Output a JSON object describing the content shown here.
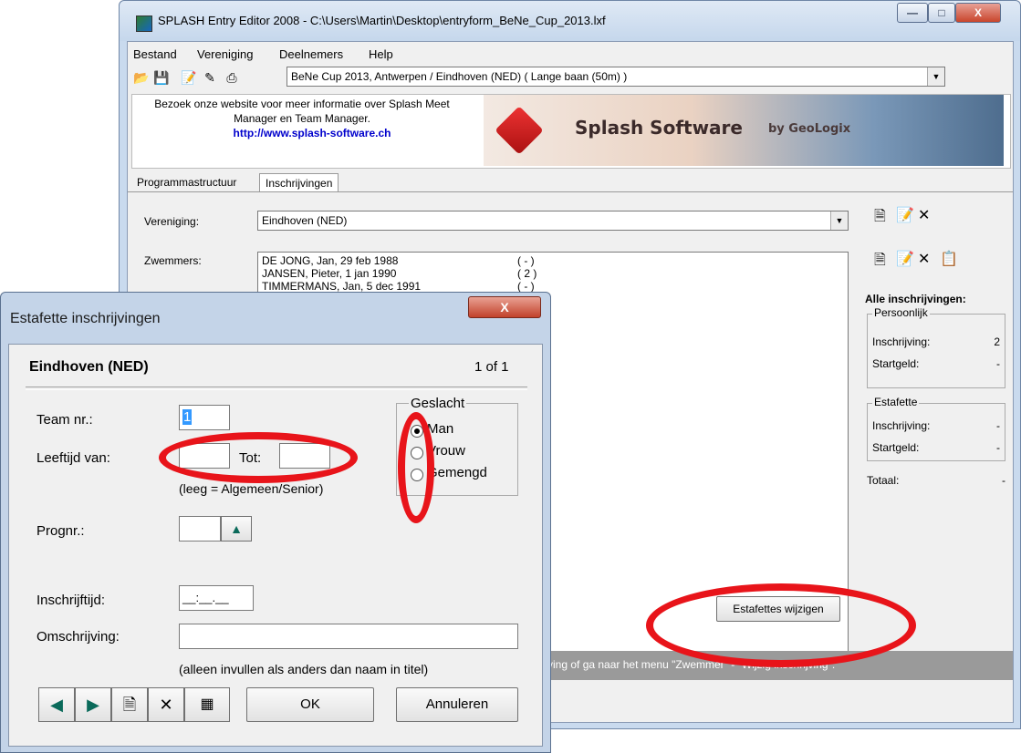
{
  "main_window": {
    "title": "SPLASH Entry Editor 2008 - C:\\Users\\Martin\\Desktop\\entryform_BeNe_Cup_2013.lxf",
    "min_label": "—",
    "max_label": "□",
    "close_label": "X",
    "menu": [
      "Bestand",
      "Vereniging",
      "Deelnemers",
      "Help"
    ],
    "meet_select": "BeNe Cup 2013,  Antwerpen / Eindhoven  (NED)   ( Lange baan (50m) )",
    "banner": {
      "text": "Bezoek onze website voor meer informatie over Splash Meet Manager en Team Manager.",
      "link": "http://www.splash-software.ch",
      "logo_text": "Splash Software",
      "logo_by": "by GeoLogix"
    },
    "tabs": [
      "Programmastructuur",
      "Inschrijvingen"
    ],
    "vereniging_label": "Vereniging:",
    "vereniging_value": "Eindhoven (NED)",
    "zwemmers_label": "Zwemmers:",
    "swimmers": [
      {
        "name": "DE JONG, Jan, 29 feb 1988",
        "entries": "( - )"
      },
      {
        "name": "JANSEN, Pieter, 1 jan 1990",
        "entries": "( 2 )"
      },
      {
        "name": "TIMMERMANS, Jan, 5 dec 1991",
        "entries": "( - )"
      }
    ],
    "summary": {
      "title": "Alle inschrijvingen:",
      "persoonlijk": "Persoonlijk",
      "estafette": "Estafette",
      "inschrijving_label": "Inschrijving:",
      "startgeld_label": "Startgeld:",
      "persoonlijk_inschrijving": "2",
      "persoonlijk_startgeld": "-",
      "estafette_inschrijving": "-",
      "estafette_startgeld": "-",
      "totaal_label": "Totaal:",
      "totaal_value": "-"
    },
    "estafettes_button": "Estafettes wijzigen",
    "status_text": "ving of ga naar het menu \"Zwemmer\" - \"Wijzig inschrijving\"."
  },
  "dialog": {
    "title": "Estafette inschrijvingen",
    "close_label": "X",
    "club": "Eindhoven (NED)",
    "pager": "1 of 1",
    "team_label": "Team nr.:",
    "team_value": "1",
    "leeftijd_label": "Leeftijd van:",
    "tot_label": "Tot:",
    "leeftijd_hint": "(leeg = Algemeen/Senior)",
    "geslacht_title": "Geslacht",
    "geslacht_options": [
      "Man",
      "Vrouw",
      "Gemengd"
    ],
    "geslacht_selected": "Man",
    "prognr_label": "Prognr.:",
    "inschrijftijd_label": "Inschrijftijd:",
    "inschrijftijd_value": "__:__.__",
    "omschrijving_label": "Omschrijving:",
    "omschrijving_hint": "(alleen invullen als anders dan naam in titel)",
    "ok_label": "OK",
    "annuleren_label": "Annuleren"
  },
  "colors": {
    "annotation": "#e8141a",
    "link": "#0000cc"
  }
}
